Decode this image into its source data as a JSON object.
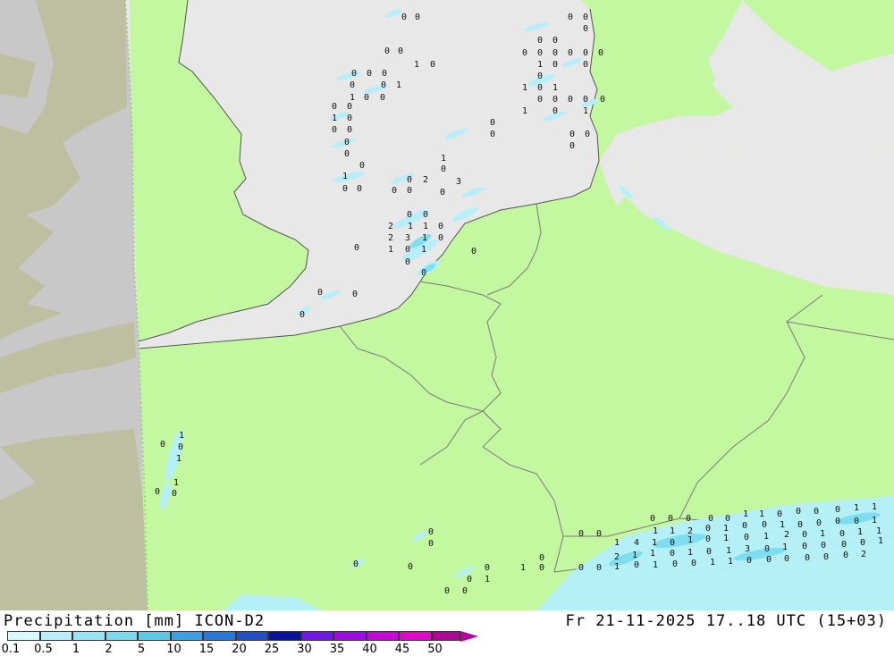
{
  "footer": {
    "title": "Precipitation [mm] ICON-D2",
    "validity": "Fr 21-11-2025 17..18 UTC (15+03)"
  },
  "legend": {
    "labels": [
      "0.1",
      "0.5",
      "1",
      "2",
      "5",
      "10",
      "15",
      "20",
      "25",
      "30",
      "35",
      "40",
      "45",
      "50"
    ],
    "colors": [
      "#d6fafe",
      "#b4f0fa",
      "#96e6f5",
      "#78dcf0",
      "#5ac8eb",
      "#3ca0e6",
      "#2878dc",
      "#1e50c8",
      "#0a14a0",
      "#7814f0",
      "#a00ae6",
      "#c800dc",
      "#e600c8",
      "#b4009a"
    ]
  },
  "colors": {
    "land": "#c3f7a0",
    "sea": "#e8e8e8",
    "outside_domain": "#c8c8c8",
    "outside_land": "#bdbfa0",
    "precip_light": "#b4f0fa",
    "precip_mid": "#78dcf0"
  },
  "values": {
    "north_sea": [
      "0",
      "0",
      "0",
      "0",
      "1",
      "0",
      "0",
      "0",
      "0",
      "0",
      "0",
      "1",
      "1",
      "0",
      "0",
      "0",
      "0",
      "1",
      "0",
      "0",
      "0",
      "0",
      "0",
      "0",
      "1",
      "0",
      "0",
      "0",
      "0",
      "0",
      "2",
      "0",
      "0",
      "2",
      "1",
      "1",
      "0",
      "2",
      "3",
      "1",
      "0",
      "1",
      "0",
      "1",
      "0",
      "3",
      "1",
      "0",
      "0",
      "0",
      "0",
      "0"
    ],
    "skagerrak": [
      "0",
      "0",
      "0",
      "0",
      "0",
      "0",
      "0",
      "0",
      "0",
      "0",
      "0",
      "1",
      "0",
      "0",
      "0",
      "1",
      "0",
      "1",
      "0",
      "0",
      "0",
      "0",
      "0",
      "1",
      "0",
      "1",
      "0",
      "0",
      "0",
      "0",
      "0"
    ],
    "channel": [
      "0",
      "1",
      "0",
      "1",
      "1",
      "0",
      "0",
      "0",
      "0",
      "0"
    ],
    "alps": [
      "0",
      "0",
      "0",
      "0",
      "0",
      "1",
      "1",
      "0",
      "0",
      "0",
      "0",
      "1",
      "1",
      "1",
      "1",
      "2",
      "0",
      "1",
      "0",
      "0",
      "1",
      "0",
      "0",
      "0",
      "0",
      "1",
      "1",
      "4",
      "1",
      "0",
      "1",
      "0",
      "1",
      "0",
      "1",
      "2",
      "0",
      "1",
      "0",
      "1",
      "1",
      "2",
      "1",
      "1",
      "0",
      "1",
      "0",
      "1",
      "3",
      "0",
      "1",
      "0",
      "0",
      "0",
      "0",
      "1",
      "1",
      "0",
      "1",
      "0",
      "0",
      "1",
      "1",
      "0",
      "0",
      "0",
      "0",
      "0",
      "0",
      "2",
      "0",
      "0",
      "0",
      "0",
      "0",
      "0",
      "0",
      "1",
      "0",
      "0",
      "0",
      "0",
      "0",
      "1",
      "0",
      "0",
      "0",
      "0",
      "1",
      "0",
      "0",
      "0",
      "0"
    ]
  }
}
